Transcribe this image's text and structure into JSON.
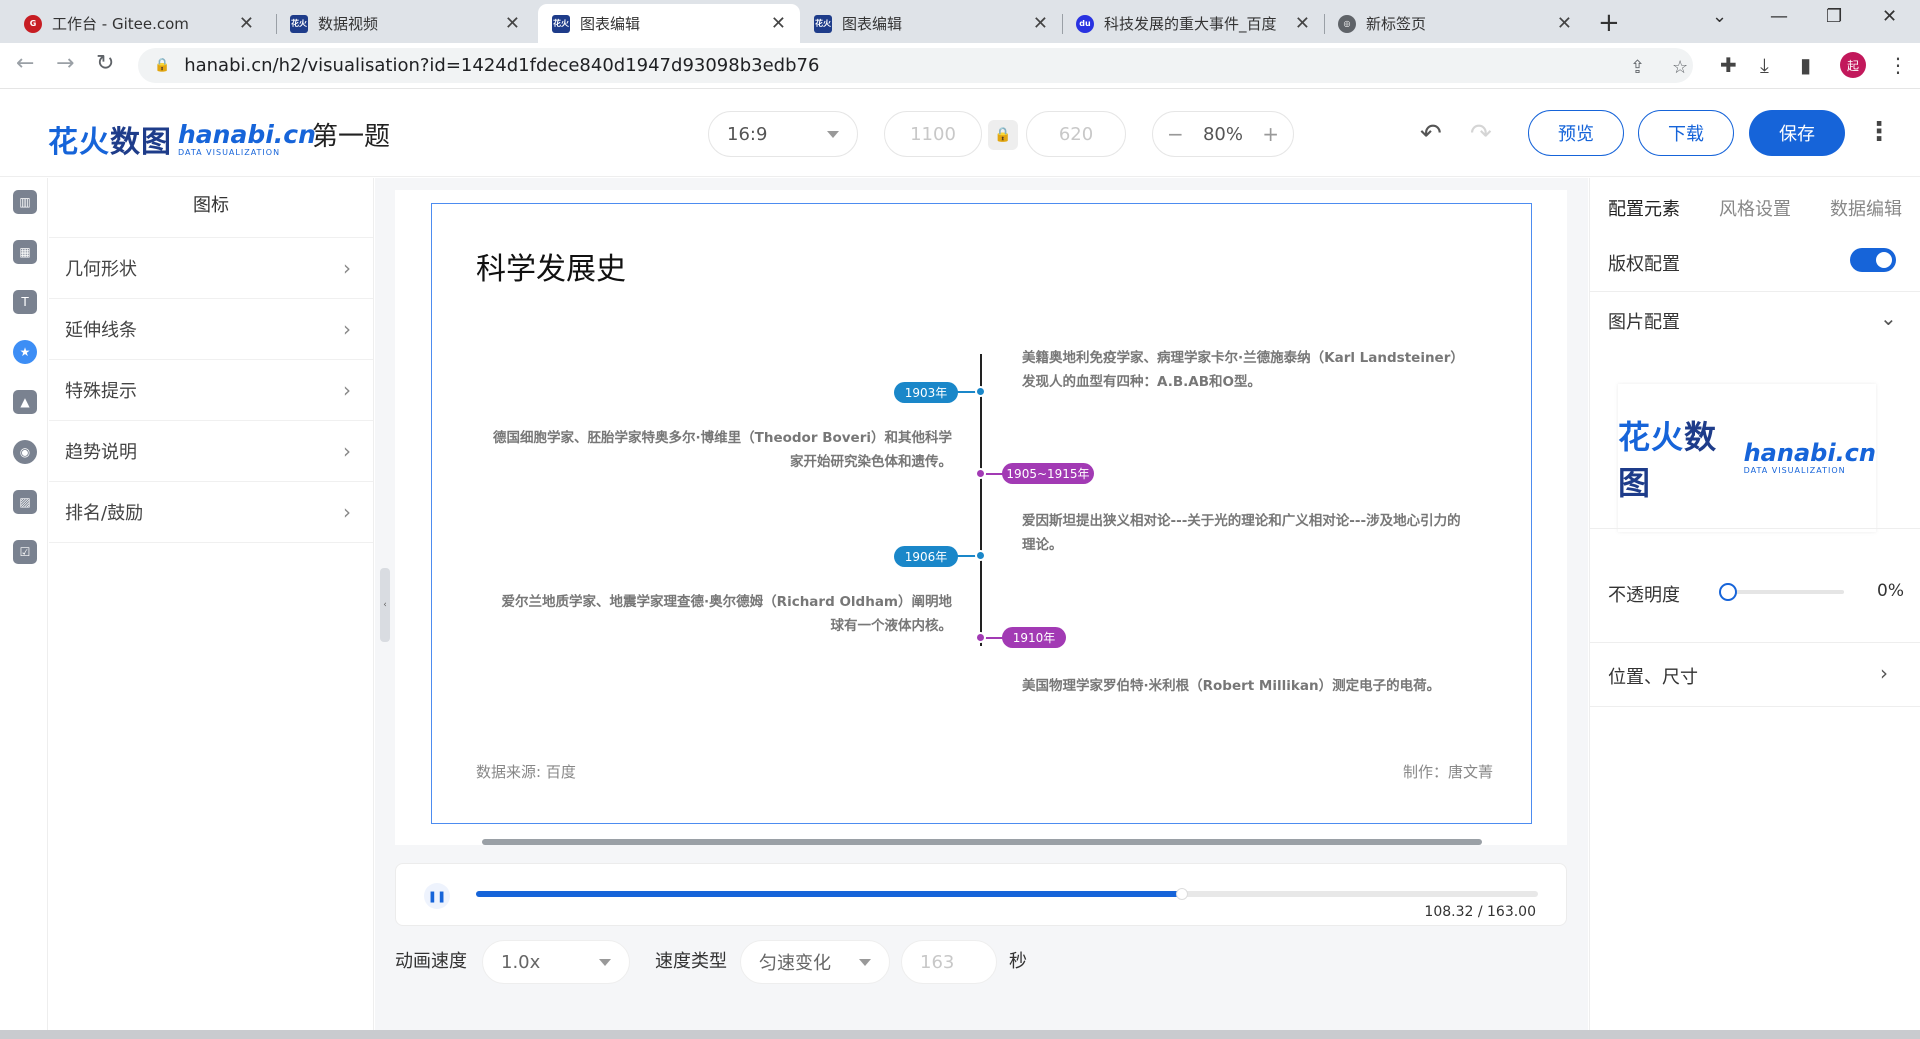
{
  "browser": {
    "tabs": [
      {
        "title": "工作台 - Gitee.com",
        "favicon_color": "#c71d23",
        "favicon_text": "G",
        "active": false
      },
      {
        "title": "数据视频",
        "favicon_color": "#1e3c8a",
        "favicon_text": "花火",
        "active": false
      },
      {
        "title": "图表编辑",
        "favicon_color": "#1e3c8a",
        "favicon_text": "花火",
        "active": true
      },
      {
        "title": "图表编辑",
        "favicon_color": "#1e3c8a",
        "favicon_text": "花火",
        "active": false
      },
      {
        "title": "科技发展的重大事件_百度",
        "favicon_color": "#2932e1",
        "favicon_text": "du",
        "active": false
      },
      {
        "title": "新标签页",
        "favicon_color": "#5f6368",
        "favicon_text": "◎",
        "active": false
      }
    ],
    "close_glyph": "✕",
    "new_tab_glyph": "+",
    "url": "hanabi.cn/h2/visualisation?id=1424d1fdece840d1947d93098b3edb76",
    "profile_initial": "起"
  },
  "header": {
    "logo_cn_1": "花火",
    "logo_cn_2": "数图",
    "logo_en": "hanabi.cn",
    "logo_en_sub": "DATA VISUALIZATION",
    "project_title": "第一题",
    "ratio": "16:9",
    "width": "1100",
    "height": "620",
    "zoom": "80%",
    "zoom_minus": "−",
    "zoom_plus": "+",
    "preview_label": "预览",
    "download_label": "下载",
    "save_label": "保存"
  },
  "rail": {
    "icons": [
      "chart-icon",
      "table-icon",
      "text-icon",
      "icon-library-icon",
      "image-icon",
      "media-icon",
      "texture-icon",
      "template-icon"
    ],
    "tooltip": "图标"
  },
  "left_panel": {
    "title": "图标",
    "items": [
      {
        "label": "几何形状"
      },
      {
        "label": "延伸线条"
      },
      {
        "label": "特殊提示"
      },
      {
        "label": "趋势说明"
      },
      {
        "label": "排名/鼓励"
      }
    ]
  },
  "slide": {
    "title": "科学发展史",
    "source": "数据来源: 百度",
    "author": "制作：唐文菁",
    "events": [
      {
        "year": "1903年",
        "color": "#1a87c9",
        "text": "美籍奥地利免疫学家、病理学家卡尔·兰德施泰纳（Karl Landsteiner）发现人的血型有四种：A.B.AB和O型。"
      },
      {
        "year": "1905~1915年",
        "color": "#a23ab4",
        "text": "德国细胞学家、胚胎学家特奥多尔·博维里（Theodor Boveri）和其他科学家开始研究染色体和遗传。"
      },
      {
        "year": "1906年",
        "color": "#1a87c9",
        "text": "爱因斯坦提出狭义相对论---关于光的理论和广义相对论---涉及地心引力的理论。"
      },
      {
        "year": "1910年",
        "color": "#a23ab4",
        "text": "爱尔兰地质学家、地震学家理查德·奥尔德姆（Richard Oldham）阐明地球有一个液体内核。"
      },
      {
        "text": "美国物理学家罗伯特·米利根（Robert Millikan）测定电子的电荷。"
      }
    ]
  },
  "player": {
    "pause_glyph": "❚❚",
    "progress": 0.6646,
    "time": "108.32 / 163.00"
  },
  "controls": {
    "speed_label": "动画速度",
    "speed_value": "1.0x",
    "speed_type_label": "速度类型",
    "speed_type_value": "匀速变化",
    "duration_value": "163",
    "seconds_label": "秒"
  },
  "right_panel": {
    "tabs": [
      "配置元素",
      "风格设置",
      "数据编辑"
    ],
    "copyright_label": "版权配置",
    "copyright_on": true,
    "image_label": "图片配置",
    "opacity_label": "不透明度",
    "opacity_value": "0%",
    "opacity": 0,
    "position_label": "位置、尺寸"
  }
}
